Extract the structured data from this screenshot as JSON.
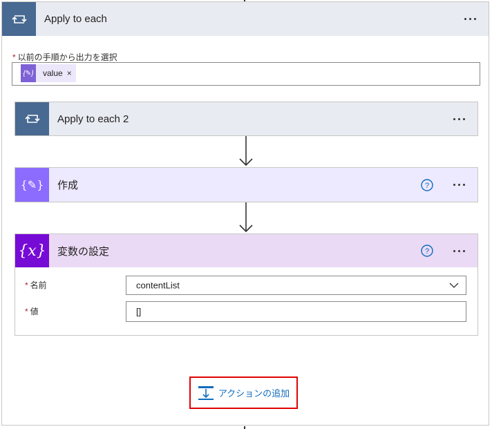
{
  "outer_action": {
    "title": "Apply to each",
    "icon": "loop-icon",
    "field_label": "以前の手順から出力を選択",
    "token": {
      "label": "value",
      "icon": "expression-icon",
      "remove": "×"
    }
  },
  "inner_loop": {
    "title": "Apply to each 2",
    "icon": "loop-icon"
  },
  "compose": {
    "title": "作成",
    "icon": "compose-icon"
  },
  "set_variable": {
    "title": "変数の設定",
    "icon": "variable-icon",
    "name_label": "名前",
    "name_value": "contentList",
    "value_label": "値",
    "value_value": "[]"
  },
  "add_action": {
    "label": "アクションの追加",
    "icon": "add-action-icon"
  },
  "required_marker": "*",
  "colors": {
    "loop_header_bg": "#e8ebf1",
    "loop_icon_bg": "#486991",
    "compose_header_bg": "#ede9fe",
    "compose_icon_bg": "#8c6cff",
    "variable_header_bg": "#ebdaf5",
    "variable_icon_bg": "#770bd6",
    "help_blue": "#0f6cbd",
    "highlight_red": "#e00000"
  }
}
